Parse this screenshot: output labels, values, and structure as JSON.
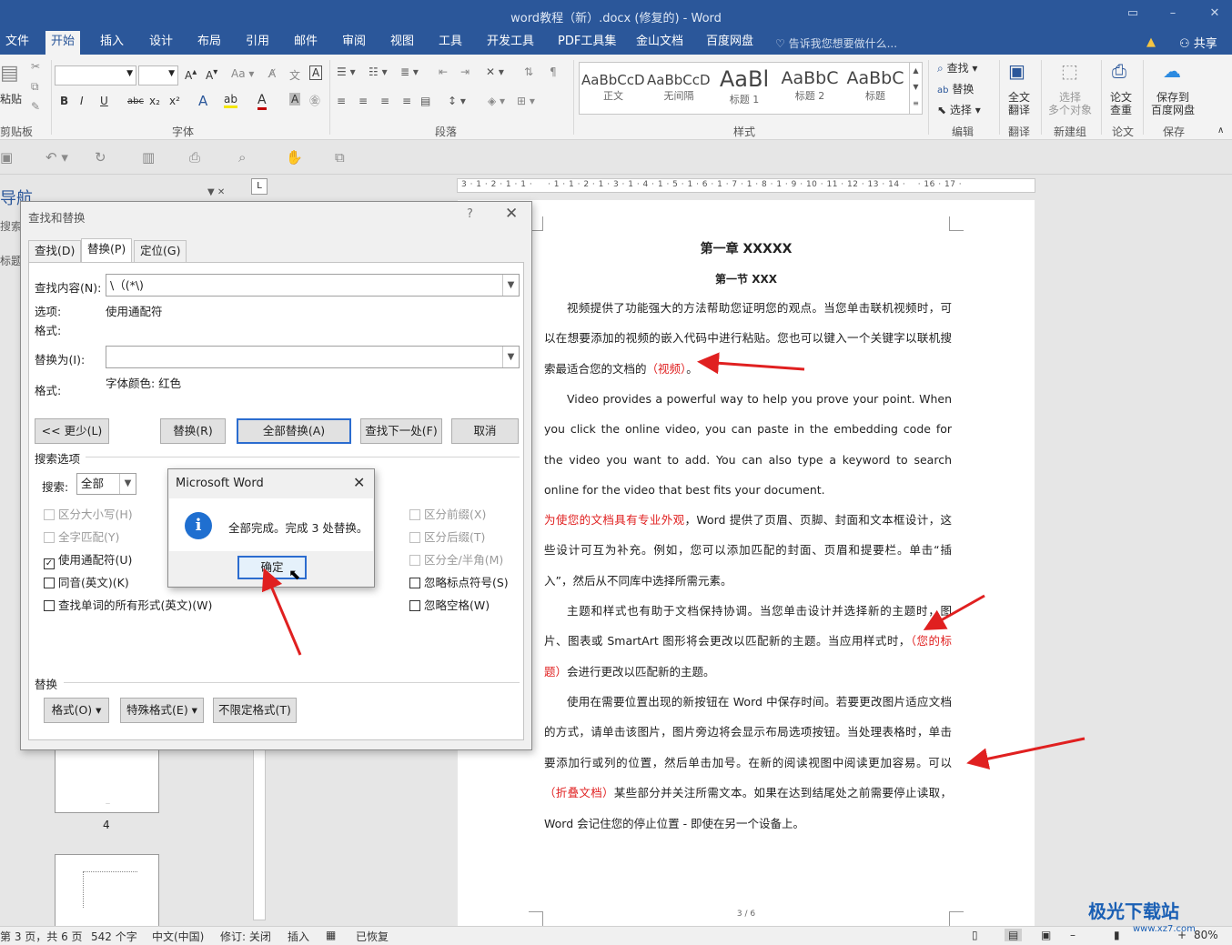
{
  "window": {
    "title": "word教程（新）.docx (修复的) - Word"
  },
  "menu_tabs": [
    "文件",
    "开始",
    "插入",
    "设计",
    "布局",
    "引用",
    "邮件",
    "审阅",
    "视图",
    "工具",
    "开发工具",
    "PDF工具集",
    "金山文档",
    "百度网盘"
  ],
  "menu_active": "开始",
  "tell_me": "告诉我您想要做什么...",
  "share": "共享",
  "ribbon": {
    "clipboard": {
      "paste": "粘贴",
      "label": "剪贴板"
    },
    "font": {
      "label": "字体",
      "buttons": [
        "B",
        "I",
        "U",
        "abc",
        "x₂",
        "x²"
      ]
    },
    "paragraph": {
      "label": "段落"
    },
    "styles": {
      "label": "样式",
      "items": [
        {
          "sample": "AaBbCcDd",
          "name": "正文"
        },
        {
          "sample": "AaBbCcDd",
          "name": "无间隔"
        },
        {
          "sample": "AaBl",
          "name": "标题 1"
        },
        {
          "sample": "AaBbC",
          "name": "标题 2"
        },
        {
          "sample": "AaBbC",
          "name": "标题"
        }
      ]
    },
    "editing": {
      "label": "编辑",
      "find": "查找",
      "replace": "替换",
      "select": "选择"
    },
    "translate": {
      "button": "全文\n翻译",
      "label": "翻译"
    },
    "newgroup": {
      "button": "选择\n多个对象",
      "label": "新建组"
    },
    "paper": {
      "button": "论文\n查重",
      "label": "论文"
    },
    "save": {
      "button": "保存到\n百度网盘",
      "label": "保存"
    }
  },
  "nav": {
    "title": "导航",
    "search": "搜索",
    "headings": "标题",
    "thumb_label": "4"
  },
  "document": {
    "h1": "第一章 XXXXX",
    "h2": "第一节 XXX",
    "p1a": "视频提供了功能强大的方法帮助您证明您的观点。当您单击联机视频时，可以在想要添加的视频的嵌入代码中进行粘贴。您也可以键入一个关键字以联机搜索最适合您的文档的",
    "p1red": "（视频）",
    "p1b": "。",
    "p2": "Video provides a powerful way to help you prove your point. When you click the online video, you can paste in the embedding code for the video you want to add. You can also type a keyword to search online for the video that best fits your document.",
    "p3red": "为使您的文档具有专业外观",
    "p3": "，Word 提供了页眉、页脚、封面和文本框设计，这些设计可互为补充。例如，您可以添加匹配的封面、页眉和提要栏。单击“插入”，然后从不同库中选择所需元素。",
    "p4a": "主题和样式也有助于文档保持协调。当您单击设计并选择新的主题时，图片、图表或 SmartArt 图形将会更改以匹配新的主题。当应用样式时，",
    "p4red": "（您的标题）",
    "p4b": "会进行更改以匹配新的主题。",
    "p5a": "使用在需要位置出现的新按钮在 Word 中保存时间。若要更改图片适应文档的方式，请单击该图片，图片旁边将会显示布局选项按钮。当处理表格时，单击要添加行或列的位置，然后单击加号。在新的阅读视图中阅读更加容易。可以",
    "p5red": "（折叠文档）",
    "p5b": "某些部分并关注所需文本。如果在达到结尾处之前需要停止读取，Word 会记住您的停止位置 - 即使在另一个设备上。",
    "page_num": "3 / 6"
  },
  "find_replace": {
    "title": "查找和替换",
    "help": "?",
    "tabs": [
      "查找(D)",
      "替换(P)",
      "定位(G)"
    ],
    "find_label": "查找内容(N):",
    "find_value": "\\（(*\\)",
    "options_label": "选项:",
    "options_value": "使用通配符",
    "format_label": "格式:",
    "replace_label": "替换为(I):",
    "replace_value": "",
    "replace_format_label": "格式:",
    "replace_format_value": "字体颜色: 红色",
    "btn_less": "<< 更少(L)",
    "btn_replace": "替换(R)",
    "btn_replace_all": "全部替换(A)",
    "btn_find_next": "查找下一处(F)",
    "btn_cancel": "取消",
    "search_options": "搜索选项",
    "search_label": "搜索:",
    "search_value": "全部",
    "left_checks": [
      {
        "label": "区分大小写(H)",
        "checked": false,
        "disabled": true
      },
      {
        "label": "全字匹配(Y)",
        "checked": false,
        "disabled": true
      },
      {
        "label": "使用通配符(U)",
        "checked": true,
        "disabled": false
      },
      {
        "label": "同音(英文)(K)",
        "checked": false,
        "disabled": false
      },
      {
        "label": "查找单词的所有形式(英文)(W)",
        "checked": false,
        "disabled": false
      }
    ],
    "right_checks": [
      {
        "label": "区分前缀(X)",
        "checked": false,
        "disabled": true
      },
      {
        "label": "区分后缀(T)",
        "checked": false,
        "disabled": true
      },
      {
        "label": "区分全/半角(M)",
        "checked": false,
        "disabled": true
      },
      {
        "label": "忽略标点符号(S)",
        "checked": false,
        "disabled": false
      },
      {
        "label": "忽略空格(W)",
        "checked": false,
        "disabled": false
      }
    ],
    "replace_section": "替换",
    "btn_format": "格式(O) ▾",
    "btn_special": "特殊格式(E) ▾",
    "btn_no_format": "不限定格式(T)"
  },
  "message_box": {
    "title": "Microsoft Word",
    "text": "全部完成。完成 3 处替换。",
    "ok": "确定"
  },
  "status": {
    "page": "第 3 页，共 6 页",
    "words": "542 个字",
    "lang": "中文(中国)",
    "track": "修订: 关闭",
    "insert": "插入",
    "recovered": "已恢复",
    "zoom": "80%"
  },
  "watermark": {
    "name": "极光下载站",
    "url": "www.xz7.com"
  },
  "colors": {
    "brand": "#2b579a",
    "annotation_red": "#e02020",
    "info_blue": "#1f6fd0"
  }
}
